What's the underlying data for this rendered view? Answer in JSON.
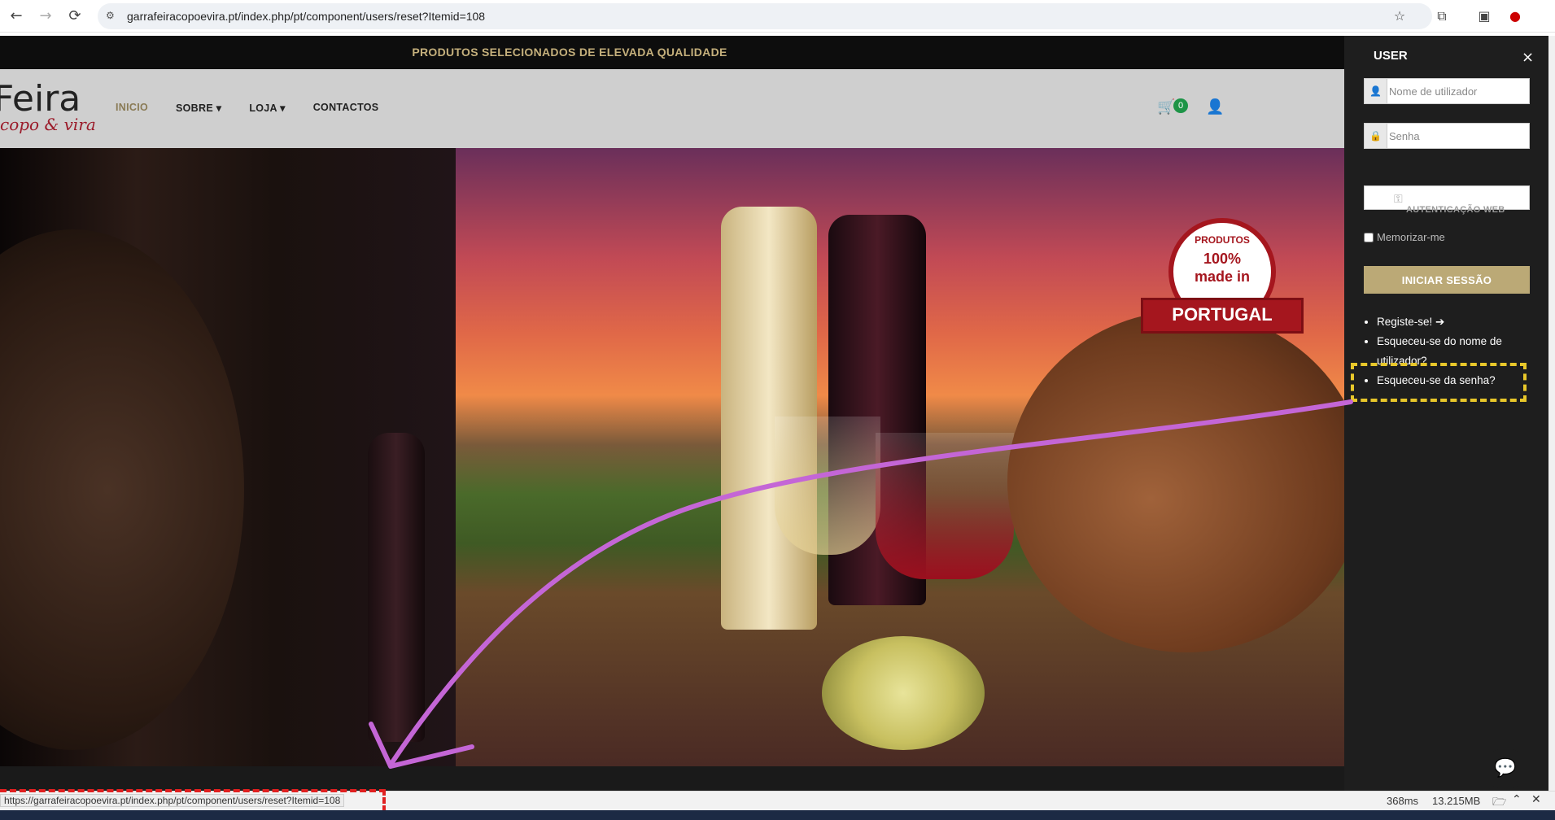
{
  "browser": {
    "url": "garrafeiracopoevira.pt/index.php/pt/component/users/reset?Itemid=108",
    "back_icon": "←",
    "forward_icon": "→",
    "reload_icon": "⟳",
    "site_info_icon": "⚙",
    "star_icon": "☆",
    "extensions_icon": "⧉",
    "sidepanel_icon": "▣"
  },
  "site": {
    "topbar_text": "PRODUTOS SELECIONADOS DE ELEVADA QUALIDADE",
    "logo_main": "Feira",
    "logo_sub": "copo & vira",
    "menu": [
      {
        "label": "INICIO",
        "active": true
      },
      {
        "label": "SOBRE ▾",
        "active": false
      },
      {
        "label": "LOJA ▾",
        "active": false
      },
      {
        "label": "CONTACTOS",
        "active": false
      }
    ],
    "cart_count": "0",
    "cart_icon": "🛒",
    "user_icon": "👤",
    "badge": {
      "line1": "PRODUTOS",
      "line2": "100%",
      "line3": "made in",
      "ribbon": "PORTUGAL"
    }
  },
  "panel": {
    "title": "USER",
    "close": "×",
    "username_placeholder": "Nome de utilizador",
    "password_placeholder": "Senha",
    "webauth_label": "AUTENTICAÇÃO WEB",
    "webauth_icon": "⚿",
    "remember_label": "Memorizar-me",
    "login_button": "INICIAR SESSÃO",
    "links": [
      "Registe-se! ➔",
      "Esqueceu-se do nome de utilizador?",
      "Esqueceu-se da senha?"
    ]
  },
  "status": {
    "hover_url": "https://garrafeiracopoevira.pt/index.php/pt/component/users/reset?Itemid=108",
    "timing": "368ms",
    "memory": "13.215MB"
  },
  "colors": {
    "accent_gold": "#bba976",
    "highlight_yellow": "#e8c72a",
    "annotation_purple": "#c466d6",
    "annotation_red": "#e02020",
    "badge_red": "#a5161e"
  }
}
